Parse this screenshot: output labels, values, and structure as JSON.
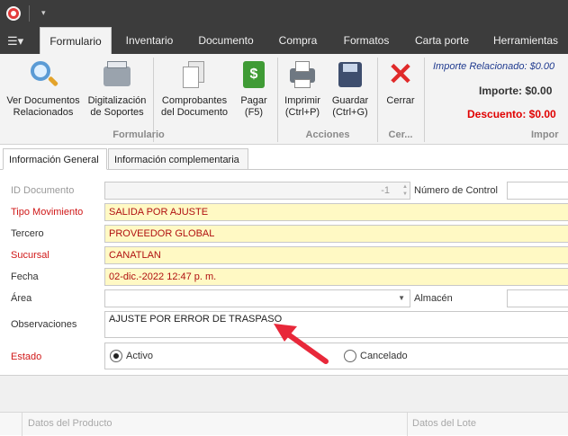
{
  "titlebar": {
    "app_icon": "app-logo-icon",
    "quick_access": "▾"
  },
  "tabs": {
    "menu_icon": "☰▾",
    "items": [
      "Formulario",
      "Inventario",
      "Documento",
      "Compra",
      "Formatos",
      "Carta porte",
      "Herramientas"
    ]
  },
  "ribbon": {
    "buttons": [
      {
        "label": "Ver Documentos\nRelacionados",
        "icon": "magnifier-icon"
      },
      {
        "label": "Digitalización\nde Soportes",
        "icon": "scanner-icon"
      },
      {
        "label": "Comprobantes\ndel Documento",
        "icon": "documents-icon"
      },
      {
        "label": "Pagar\n(F5)",
        "icon": "money-icon"
      },
      {
        "label": "Imprimir\n(Ctrl+P)",
        "icon": "printer-icon"
      },
      {
        "label": "Guardar\n(Ctrl+G)",
        "icon": "save-icon"
      },
      {
        "label": "Cerrar",
        "icon": "close-icon"
      }
    ],
    "groups": [
      "Formulario",
      "Acciones",
      "Cer...",
      "Impor"
    ],
    "totals": {
      "importe_relacionado": "Importe Relacionado: $0.00",
      "importe": "Importe: $0.00",
      "descuento": "Descuento: $0.00"
    }
  },
  "form_tabs": [
    "Información General",
    "Información complementaria"
  ],
  "form": {
    "id_documento": {
      "label": "ID Documento",
      "value": "-1"
    },
    "numero_control": {
      "label": "Número de Control",
      "value": ""
    },
    "tipo_movimiento": {
      "label": "Tipo Movimiento",
      "value": "SALIDA POR AJUSTE"
    },
    "tercero": {
      "label": "Tercero",
      "value": "PROVEEDOR GLOBAL"
    },
    "sucursal": {
      "label": "Sucursal",
      "value": "CANATLAN"
    },
    "fecha": {
      "label": "Fecha",
      "value": "02-dic.-2022 12:47 p. m."
    },
    "area": {
      "label": "Área",
      "value": ""
    },
    "almacen": {
      "label": "Almacén",
      "value": ""
    },
    "observaciones": {
      "label": "Observaciones",
      "value": "AJUSTE POR ERROR DE TRASPASO"
    },
    "estado": {
      "label": "Estado",
      "options": [
        "Activo",
        "Cancelado"
      ],
      "selected": "Activo"
    }
  },
  "grid": {
    "headers": [
      "Datos del Producto",
      "Datos del Lote"
    ]
  },
  "colors": {
    "titlebar": "#3c3c3c",
    "required": "#d01818",
    "highlight": "#fff9c4",
    "arrow": "#e8283a"
  }
}
